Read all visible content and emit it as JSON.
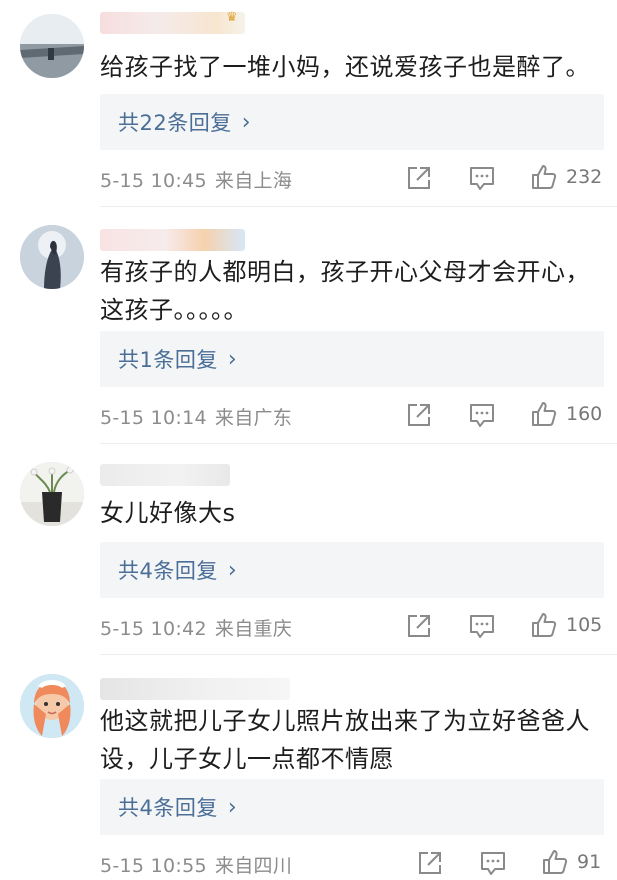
{
  "comments": [
    {
      "text": "给孩子找了一堆小妈，还说爱孩子也是醉了。",
      "reply_label": "共22条回复",
      "reply_chevron": "›",
      "time": "5-15 10:45",
      "location": "来自上海",
      "likes": "232"
    },
    {
      "text": "有孩子的人都明白，孩子开心父母才会开心，这孩子。。。。。",
      "reply_label": "共1条回复",
      "reply_chevron": "›",
      "time": "5-15 10:14",
      "location": "来自广东",
      "likes": "160"
    },
    {
      "text": "女儿好像大s",
      "reply_label": "共4条回复",
      "reply_chevron": "›",
      "time": "5-15 10:42",
      "location": "来自重庆",
      "likes": "105"
    },
    {
      "text": "他这就把儿子女儿照片放出来了为立好爸爸人设，儿子女儿一点都不情愿",
      "reply_label": "共4条回复",
      "reply_chevron": "›",
      "time": "5-15 10:55",
      "location": "来自四川",
      "likes": "91"
    }
  ],
  "icons": {
    "share": "share-icon",
    "comment": "comment-icon",
    "like": "thumbs-up-icon"
  },
  "colors": {
    "reply_link": "#4a6e96",
    "meta_text": "#8c8c8c",
    "reply_bg": "#f4f5f7"
  }
}
